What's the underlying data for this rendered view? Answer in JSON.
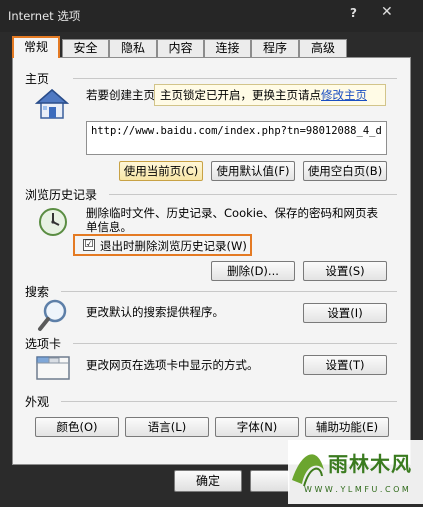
{
  "window": {
    "title": "Internet 选项",
    "help": "?",
    "close": "✕"
  },
  "tabs": [
    {
      "label": "常规",
      "active": true
    },
    {
      "label": "安全"
    },
    {
      "label": "隐私"
    },
    {
      "label": "内容"
    },
    {
      "label": "连接"
    },
    {
      "label": "程序"
    },
    {
      "label": "高级"
    }
  ],
  "home": {
    "section": "主页",
    "desc": "若要创建主页",
    "tooltip_text": "主页锁定已开启，更换主页请点",
    "tooltip_link": "修改主页",
    "url": "http://www.baidu.com/index.php?tn=98012088_4_d _",
    "btn_current": "使用当前页(C)",
    "btn_default": "使用默认值(F)",
    "btn_blank": "使用空白页(B)"
  },
  "history": {
    "section": "浏览历史记录",
    "desc": "删除临时文件、历史记录、Cookie、保存的密码和网页表单信息。",
    "checkbox_label": "退出时删除浏览历史记录(W)",
    "checked": true,
    "checkmark": "☑",
    "btn_delete": "删除(D)...",
    "btn_settings": "设置(S)"
  },
  "search": {
    "section": "搜索",
    "desc": "更改默认的搜索提供程序。",
    "btn_settings": "设置(I)"
  },
  "tabsec": {
    "section": "选项卡",
    "desc": "更改网页在选项卡中显示的方式。",
    "btn_settings": "设置(T)"
  },
  "appearance": {
    "section": "外观",
    "btn_colors": "颜色(O)",
    "btn_languages": "语言(L)",
    "btn_fonts": "字体(N)",
    "btn_accessibility": "辅助功能(E)"
  },
  "footer": {
    "btn_ok": "确定"
  },
  "watermark": {
    "text": "雨林木风",
    "url": "W W W . Y L M F U . C O M"
  },
  "colors": {
    "accent": "#e47a23",
    "link": "#1b4fc2",
    "panel": "#f4f4f4"
  }
}
